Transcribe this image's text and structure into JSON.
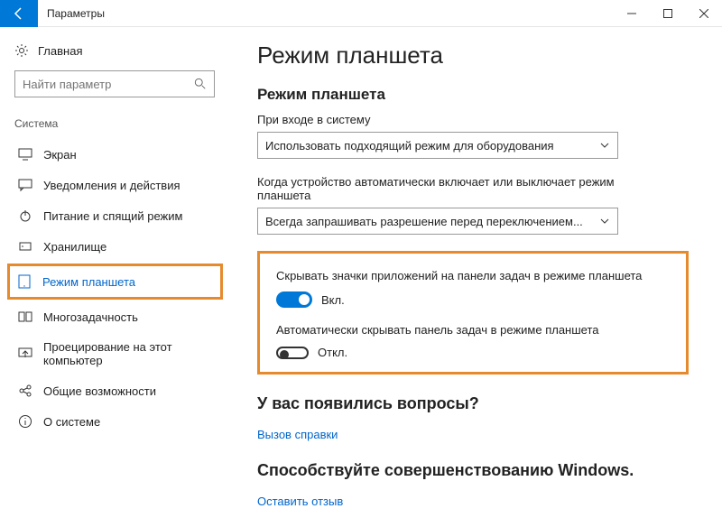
{
  "window": {
    "title": "Параметры"
  },
  "sidebar": {
    "home": "Главная",
    "search_placeholder": "Найти параметр",
    "section": "Система",
    "items": [
      {
        "label": "Экран"
      },
      {
        "label": "Уведомления и действия"
      },
      {
        "label": "Питание и спящий режим"
      },
      {
        "label": "Хранилище"
      },
      {
        "label": "Режим планшета",
        "selected": true
      },
      {
        "label": "Многозадачность"
      },
      {
        "label": "Проецирование на этот компьютер"
      },
      {
        "label": "Общие возможности"
      },
      {
        "label": "О системе"
      }
    ]
  },
  "main": {
    "page_title": "Режим планшета",
    "section1_heading": "Режим планшета",
    "signin_label": "При входе в систему",
    "signin_value": "Использовать подходящий режим для оборудования",
    "auto_switch_label": "Когда устройство автоматически включает или выключает режим планшета",
    "auto_switch_value": "Всегда запрашивать разрешение перед переключением...",
    "toggle1_label": "Скрывать значки приложений на панели задач в режиме планшета",
    "toggle1_state": "Вкл.",
    "toggle2_label": "Автоматически скрывать панель задач в режиме планшета",
    "toggle2_state": "Откл.",
    "questions_heading": "У вас появились вопросы?",
    "help_link": "Вызов справки",
    "feedback_heading": "Способствуйте совершенствованию Windows.",
    "feedback_link": "Оставить отзыв"
  }
}
